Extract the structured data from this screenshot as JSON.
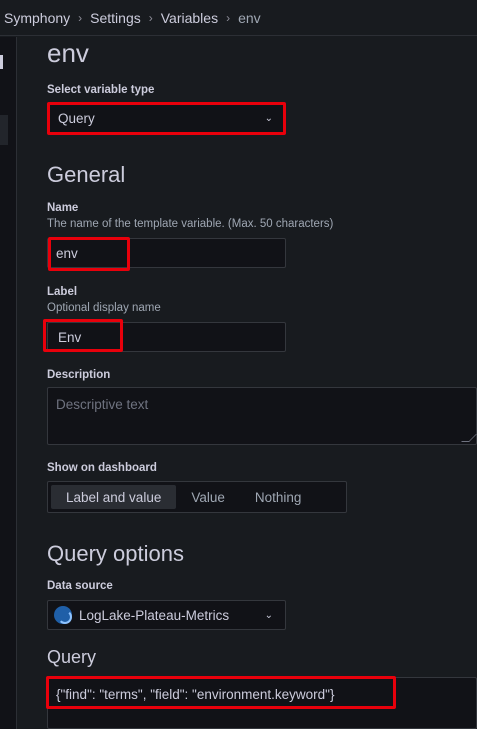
{
  "breadcrumb": {
    "items": [
      "Symphony",
      "Settings",
      "Variables"
    ],
    "current": "env",
    "separator": "›"
  },
  "page": {
    "title": "env"
  },
  "variable_type": {
    "label": "Select variable type",
    "value": "Query"
  },
  "general": {
    "heading": "General",
    "name": {
      "label": "Name",
      "description": "The name of the template variable. (Max. 50 characters)",
      "value": "env"
    },
    "display_label": {
      "label": "Label",
      "description": "Optional display name",
      "value": "Env"
    },
    "description": {
      "label": "Description",
      "placeholder": "Descriptive text"
    },
    "show_on_dashboard": {
      "label": "Show on dashboard",
      "options": [
        "Label and value",
        "Value",
        "Nothing"
      ],
      "selected": "Label and value"
    }
  },
  "query_options": {
    "heading": "Query options",
    "data_source": {
      "label": "Data source",
      "value": "LogLake-Plateau-Metrics"
    },
    "query": {
      "heading": "Query",
      "value": "{\"find\": \"terms\", \"field\": \"environment.keyword\"}"
    }
  },
  "colors": {
    "background": "#181b1f",
    "input_background": "#111217",
    "highlight": "#e8000b",
    "text": "#ccccdc",
    "muted_text": "#9fa7b3"
  },
  "icons": {
    "dropdown": "chevron-down-icon",
    "data_source": "loglake-datasource-icon"
  }
}
